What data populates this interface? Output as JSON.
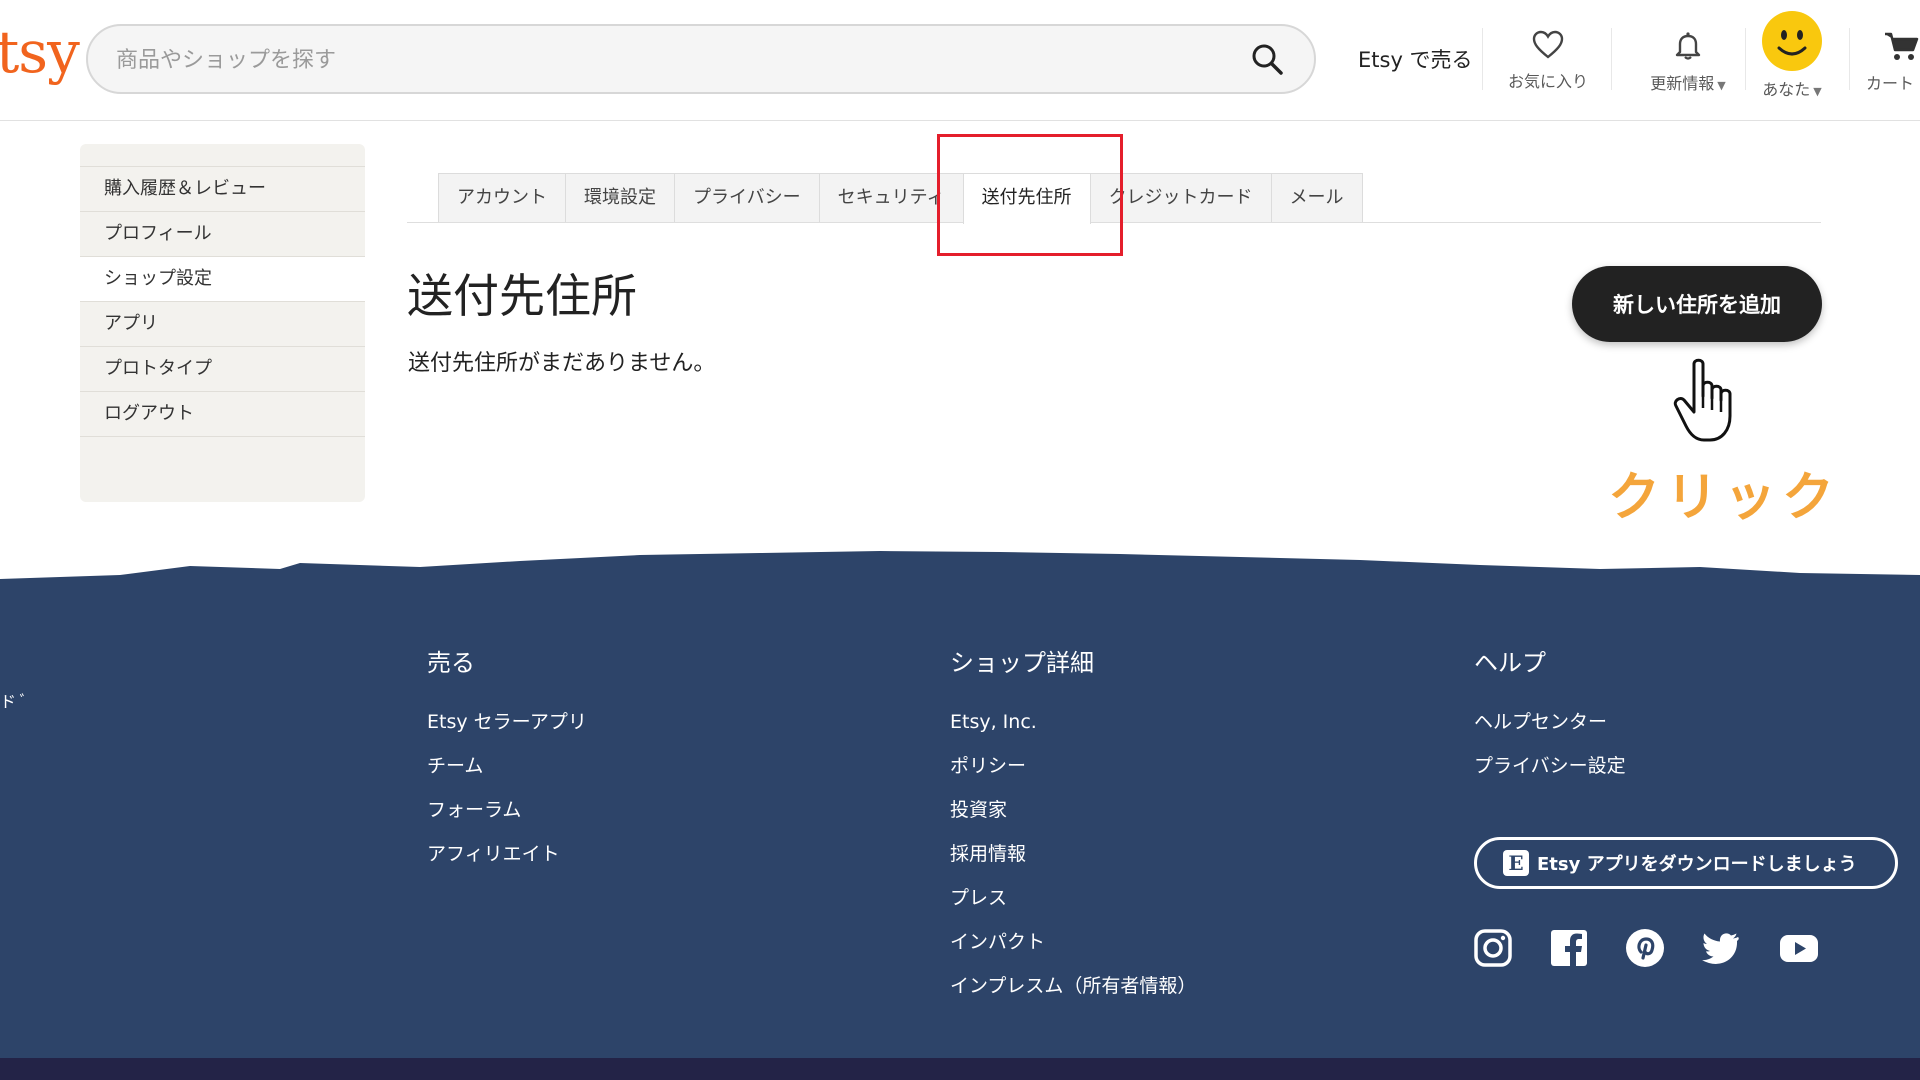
{
  "header": {
    "logo": "tsy",
    "search_placeholder": "商品やショップを探す",
    "sell_link": "Etsy で売る",
    "favorites_label": "お気に入り",
    "updates_label": "更新情報",
    "account_label": "あなた",
    "cart_label": "カート"
  },
  "sidebar": {
    "items": [
      {
        "label": "購入履歴＆レビュー"
      },
      {
        "label": "プロフィール"
      },
      {
        "label": "ショップ設定"
      },
      {
        "label": "アプリ"
      },
      {
        "label": "プロトタイプ"
      },
      {
        "label": "ログアウト"
      }
    ]
  },
  "tabs": [
    {
      "label": "アカウント"
    },
    {
      "label": "環境設定"
    },
    {
      "label": "プライバシー"
    },
    {
      "label": "セキュリティ"
    },
    {
      "label": "送付先住所"
    },
    {
      "label": "クレジットカード"
    },
    {
      "label": "メール"
    }
  ],
  "main": {
    "title": "送付先住所",
    "empty_message": "送付先住所がまだありません。",
    "add_button": "新しい住所を追加"
  },
  "annotation": {
    "click_label": "クリック",
    "highlight_color": "#e41e2b",
    "label_color": "#f4a53b"
  },
  "footer": {
    "left_items": [
      "ド",
      "ﾞ"
    ],
    "sell": {
      "title": "売る",
      "links": [
        "Etsy セラーアプリ",
        "チーム",
        "フォーラム",
        "アフィリエイト"
      ]
    },
    "shop": {
      "title": "ショップ詳細",
      "links": [
        "Etsy, Inc.",
        "ポリシー",
        "投資家",
        "採用情報",
        "プレス",
        "インパクト",
        "インプレスム（所有者情報）"
      ]
    },
    "help": {
      "title": "ヘルプ",
      "links": [
        "ヘルプセンター",
        "プライバシー設定"
      ]
    },
    "app_button": "Etsy アプリをダウンロードしましょう",
    "app_icon_letter": "E",
    "background": "#2d4469"
  },
  "colors": {
    "brand": "#f1641e",
    "button_dark": "#222222"
  }
}
